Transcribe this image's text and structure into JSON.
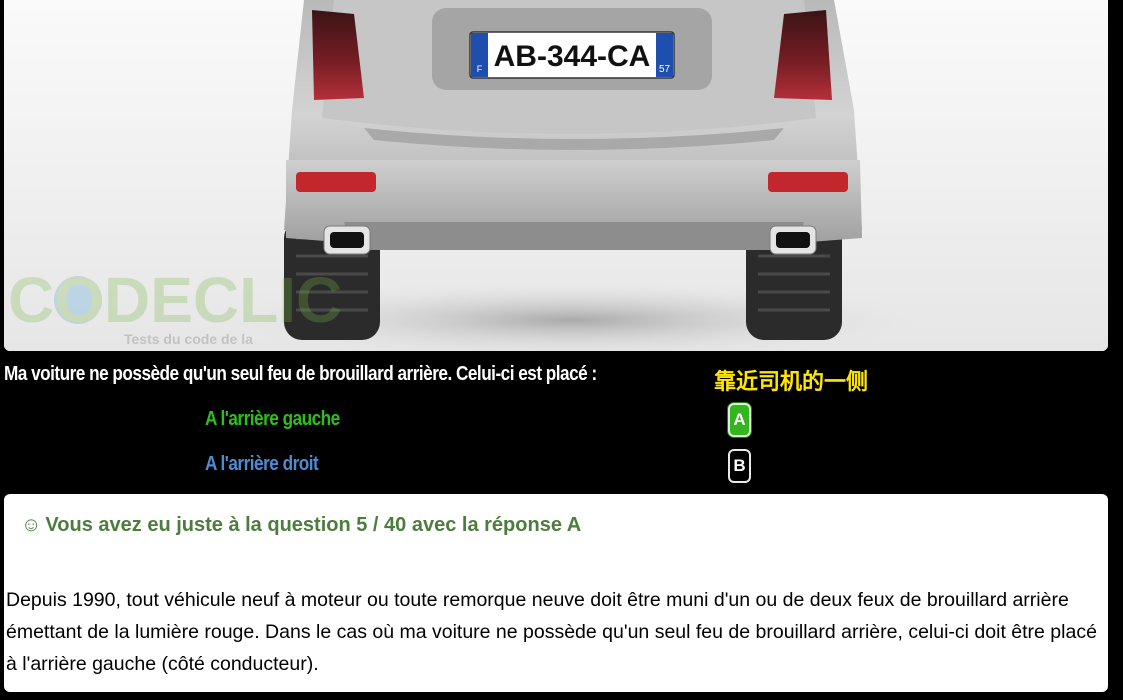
{
  "photo": {
    "plate_text": "AB-344-CA",
    "plate_country": "F",
    "plate_department": "57",
    "watermark_brand": "CODECLIC",
    "watermark_tagline": "Tests du code de la"
  },
  "question": {
    "text": "Ma voiture ne possède qu'un seul feu de brouillard arrière. Celui-ci est placé :",
    "annotation": "靠近司机的一侧"
  },
  "answers": [
    {
      "label": "A l'arrière gauche",
      "key": "A",
      "color": "#2fbf1c",
      "selected": true
    },
    {
      "label": "A l'arrière droit",
      "key": "B",
      "color": "#4f8bd1",
      "selected": false
    }
  ],
  "result": {
    "icon": "smiley-icon",
    "icon_glyph": "☺",
    "title": "Vous avez eu juste à la question 5 / 40 avec la réponse A",
    "explanation": "Depuis 1990, tout véhicule neuf à moteur ou toute remorque neuve doit être muni d'un ou de deux feux de brouillard arrière émettant de la lumière rouge. Dans le cas où ma voiture ne possède qu'un seul feu de brouillard arrière, celui-ci doit être placé à l'arrière gauche (côté conducteur)."
  },
  "colors": {
    "background": "#000000",
    "correct_green": "#33b51f",
    "result_title": "#4d7d3c",
    "annotation_yellow": "#ffe600"
  }
}
